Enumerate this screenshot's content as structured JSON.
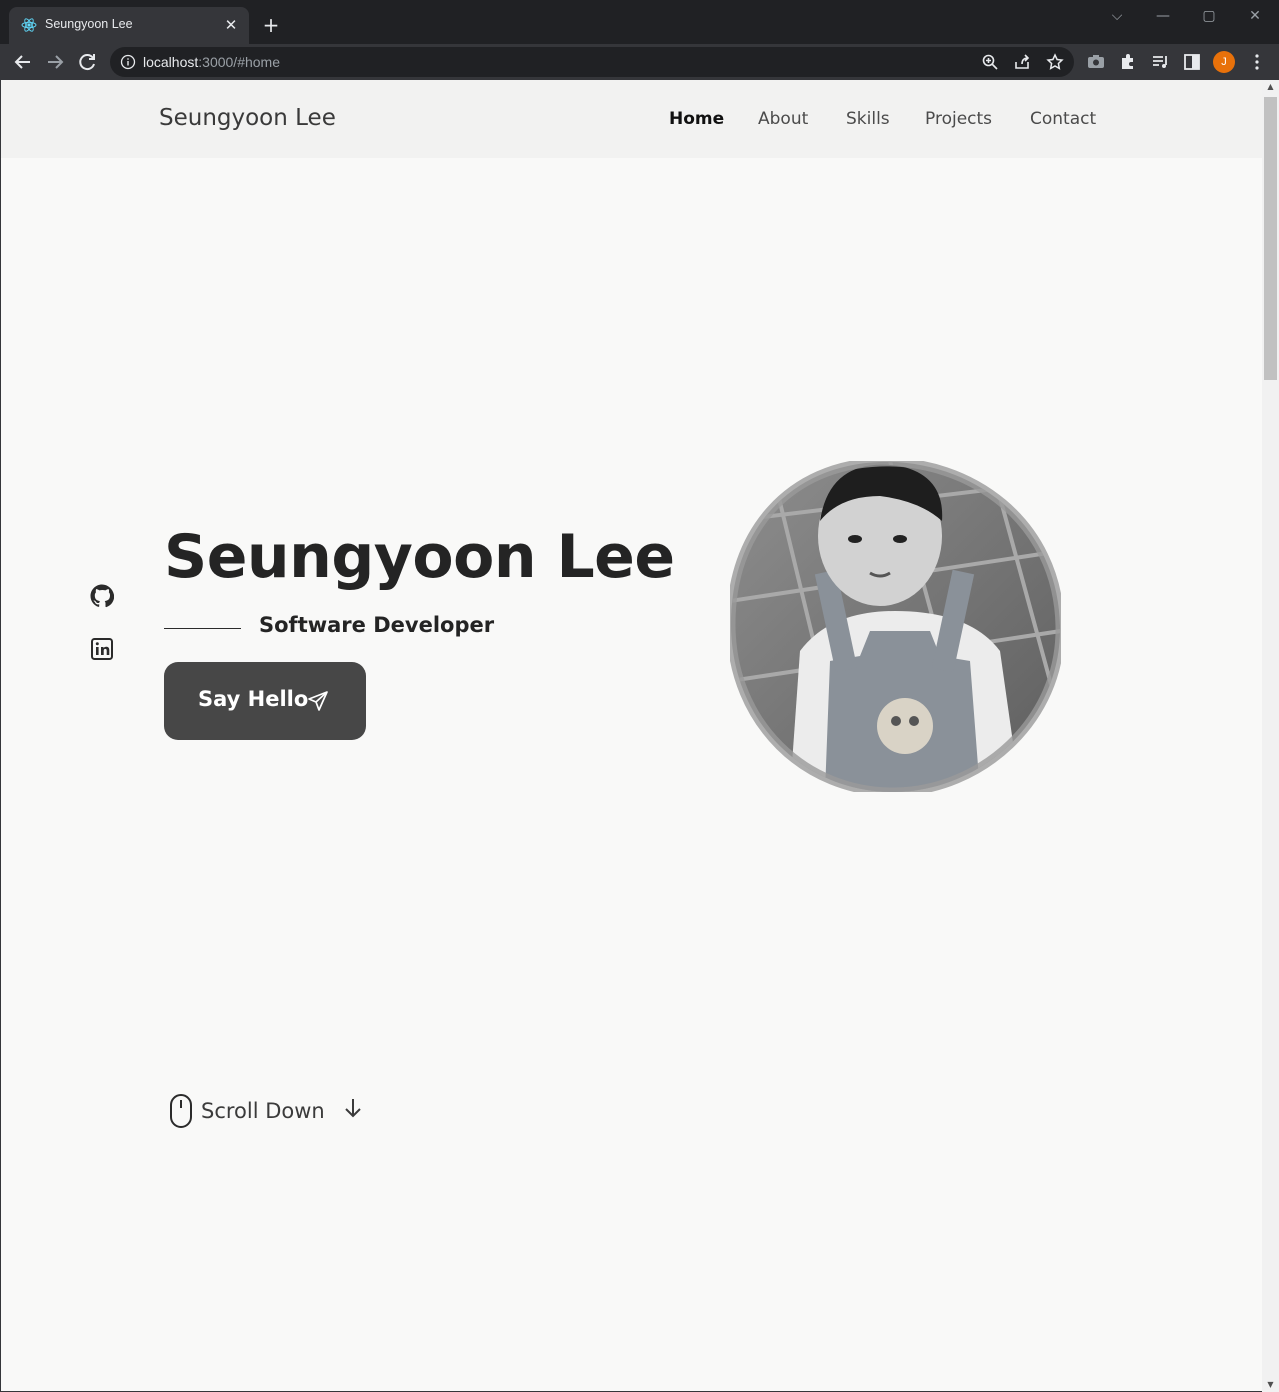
{
  "browser": {
    "tab_title": "Seungyoon Lee",
    "tab_close": "✕",
    "new_tab": "+",
    "url_host": "localhost",
    "url_rest": ":3000/#home",
    "profile_initial": "J",
    "profile_color": "#e8710a",
    "window_controls": [
      "⌵",
      "—",
      "▢",
      "✕"
    ]
  },
  "site": {
    "logo": "Seungyoon Lee",
    "nav": [
      {
        "label": "Home",
        "active": true
      },
      {
        "label": "About",
        "active": false
      },
      {
        "label": "Skills",
        "active": false
      },
      {
        "label": "Projects",
        "active": false
      },
      {
        "label": "Contact",
        "active": false
      }
    ]
  },
  "hero": {
    "title": "Seungyoon Lee",
    "subtitle": "Software Developer",
    "cta_label": "Say Hello",
    "social": [
      "github-icon",
      "linkedin-icon"
    ],
    "scroll_label": "Scroll Down"
  },
  "colors": {
    "page_bg": "#f9f9f8",
    "header_bg": "#f2f2f1",
    "button_bg": "#474747",
    "text_dark": "#242424"
  }
}
